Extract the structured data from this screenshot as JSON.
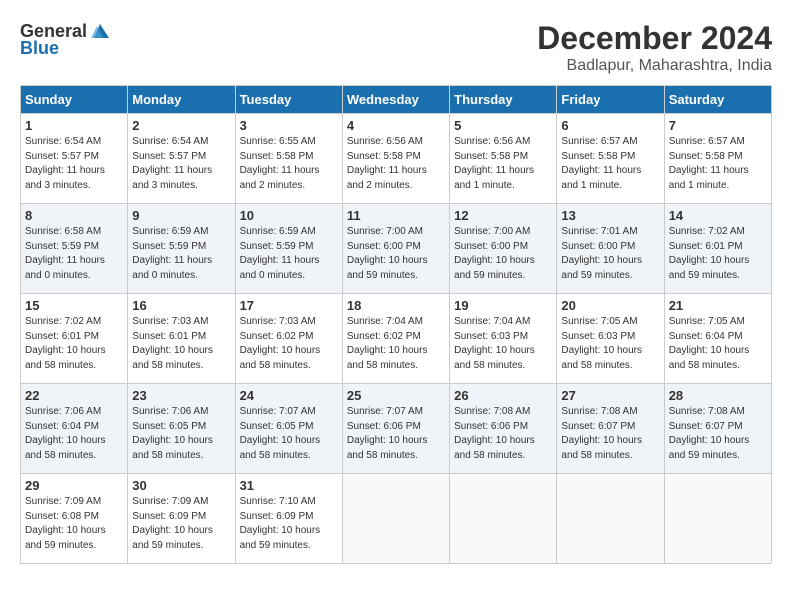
{
  "header": {
    "logo_general": "General",
    "logo_blue": "Blue",
    "month": "December 2024",
    "location": "Badlapur, Maharashtra, India"
  },
  "weekdays": [
    "Sunday",
    "Monday",
    "Tuesday",
    "Wednesday",
    "Thursday",
    "Friday",
    "Saturday"
  ],
  "weeks": [
    [
      {
        "day": "1",
        "sunrise": "6:54 AM",
        "sunset": "5:57 PM",
        "daylight": "11 hours and 3 minutes."
      },
      {
        "day": "2",
        "sunrise": "6:54 AM",
        "sunset": "5:57 PM",
        "daylight": "11 hours and 3 minutes."
      },
      {
        "day": "3",
        "sunrise": "6:55 AM",
        "sunset": "5:58 PM",
        "daylight": "11 hours and 2 minutes."
      },
      {
        "day": "4",
        "sunrise": "6:56 AM",
        "sunset": "5:58 PM",
        "daylight": "11 hours and 2 minutes."
      },
      {
        "day": "5",
        "sunrise": "6:56 AM",
        "sunset": "5:58 PM",
        "daylight": "11 hours and 1 minute."
      },
      {
        "day": "6",
        "sunrise": "6:57 AM",
        "sunset": "5:58 PM",
        "daylight": "11 hours and 1 minute."
      },
      {
        "day": "7",
        "sunrise": "6:57 AM",
        "sunset": "5:58 PM",
        "daylight": "11 hours and 1 minute."
      }
    ],
    [
      {
        "day": "8",
        "sunrise": "6:58 AM",
        "sunset": "5:59 PM",
        "daylight": "11 hours and 0 minutes."
      },
      {
        "day": "9",
        "sunrise": "6:59 AM",
        "sunset": "5:59 PM",
        "daylight": "11 hours and 0 minutes."
      },
      {
        "day": "10",
        "sunrise": "6:59 AM",
        "sunset": "5:59 PM",
        "daylight": "11 hours and 0 minutes."
      },
      {
        "day": "11",
        "sunrise": "7:00 AM",
        "sunset": "6:00 PM",
        "daylight": "10 hours and 59 minutes."
      },
      {
        "day": "12",
        "sunrise": "7:00 AM",
        "sunset": "6:00 PM",
        "daylight": "10 hours and 59 minutes."
      },
      {
        "day": "13",
        "sunrise": "7:01 AM",
        "sunset": "6:00 PM",
        "daylight": "10 hours and 59 minutes."
      },
      {
        "day": "14",
        "sunrise": "7:02 AM",
        "sunset": "6:01 PM",
        "daylight": "10 hours and 59 minutes."
      }
    ],
    [
      {
        "day": "15",
        "sunrise": "7:02 AM",
        "sunset": "6:01 PM",
        "daylight": "10 hours and 58 minutes."
      },
      {
        "day": "16",
        "sunrise": "7:03 AM",
        "sunset": "6:01 PM",
        "daylight": "10 hours and 58 minutes."
      },
      {
        "day": "17",
        "sunrise": "7:03 AM",
        "sunset": "6:02 PM",
        "daylight": "10 hours and 58 minutes."
      },
      {
        "day": "18",
        "sunrise": "7:04 AM",
        "sunset": "6:02 PM",
        "daylight": "10 hours and 58 minutes."
      },
      {
        "day": "19",
        "sunrise": "7:04 AM",
        "sunset": "6:03 PM",
        "daylight": "10 hours and 58 minutes."
      },
      {
        "day": "20",
        "sunrise": "7:05 AM",
        "sunset": "6:03 PM",
        "daylight": "10 hours and 58 minutes."
      },
      {
        "day": "21",
        "sunrise": "7:05 AM",
        "sunset": "6:04 PM",
        "daylight": "10 hours and 58 minutes."
      }
    ],
    [
      {
        "day": "22",
        "sunrise": "7:06 AM",
        "sunset": "6:04 PM",
        "daylight": "10 hours and 58 minutes."
      },
      {
        "day": "23",
        "sunrise": "7:06 AM",
        "sunset": "6:05 PM",
        "daylight": "10 hours and 58 minutes."
      },
      {
        "day": "24",
        "sunrise": "7:07 AM",
        "sunset": "6:05 PM",
        "daylight": "10 hours and 58 minutes."
      },
      {
        "day": "25",
        "sunrise": "7:07 AM",
        "sunset": "6:06 PM",
        "daylight": "10 hours and 58 minutes."
      },
      {
        "day": "26",
        "sunrise": "7:08 AM",
        "sunset": "6:06 PM",
        "daylight": "10 hours and 58 minutes."
      },
      {
        "day": "27",
        "sunrise": "7:08 AM",
        "sunset": "6:07 PM",
        "daylight": "10 hours and 58 minutes."
      },
      {
        "day": "28",
        "sunrise": "7:08 AM",
        "sunset": "6:07 PM",
        "daylight": "10 hours and 59 minutes."
      }
    ],
    [
      {
        "day": "29",
        "sunrise": "7:09 AM",
        "sunset": "6:08 PM",
        "daylight": "10 hours and 59 minutes."
      },
      {
        "day": "30",
        "sunrise": "7:09 AM",
        "sunset": "6:09 PM",
        "daylight": "10 hours and 59 minutes."
      },
      {
        "day": "31",
        "sunrise": "7:10 AM",
        "sunset": "6:09 PM",
        "daylight": "10 hours and 59 minutes."
      },
      null,
      null,
      null,
      null
    ]
  ]
}
